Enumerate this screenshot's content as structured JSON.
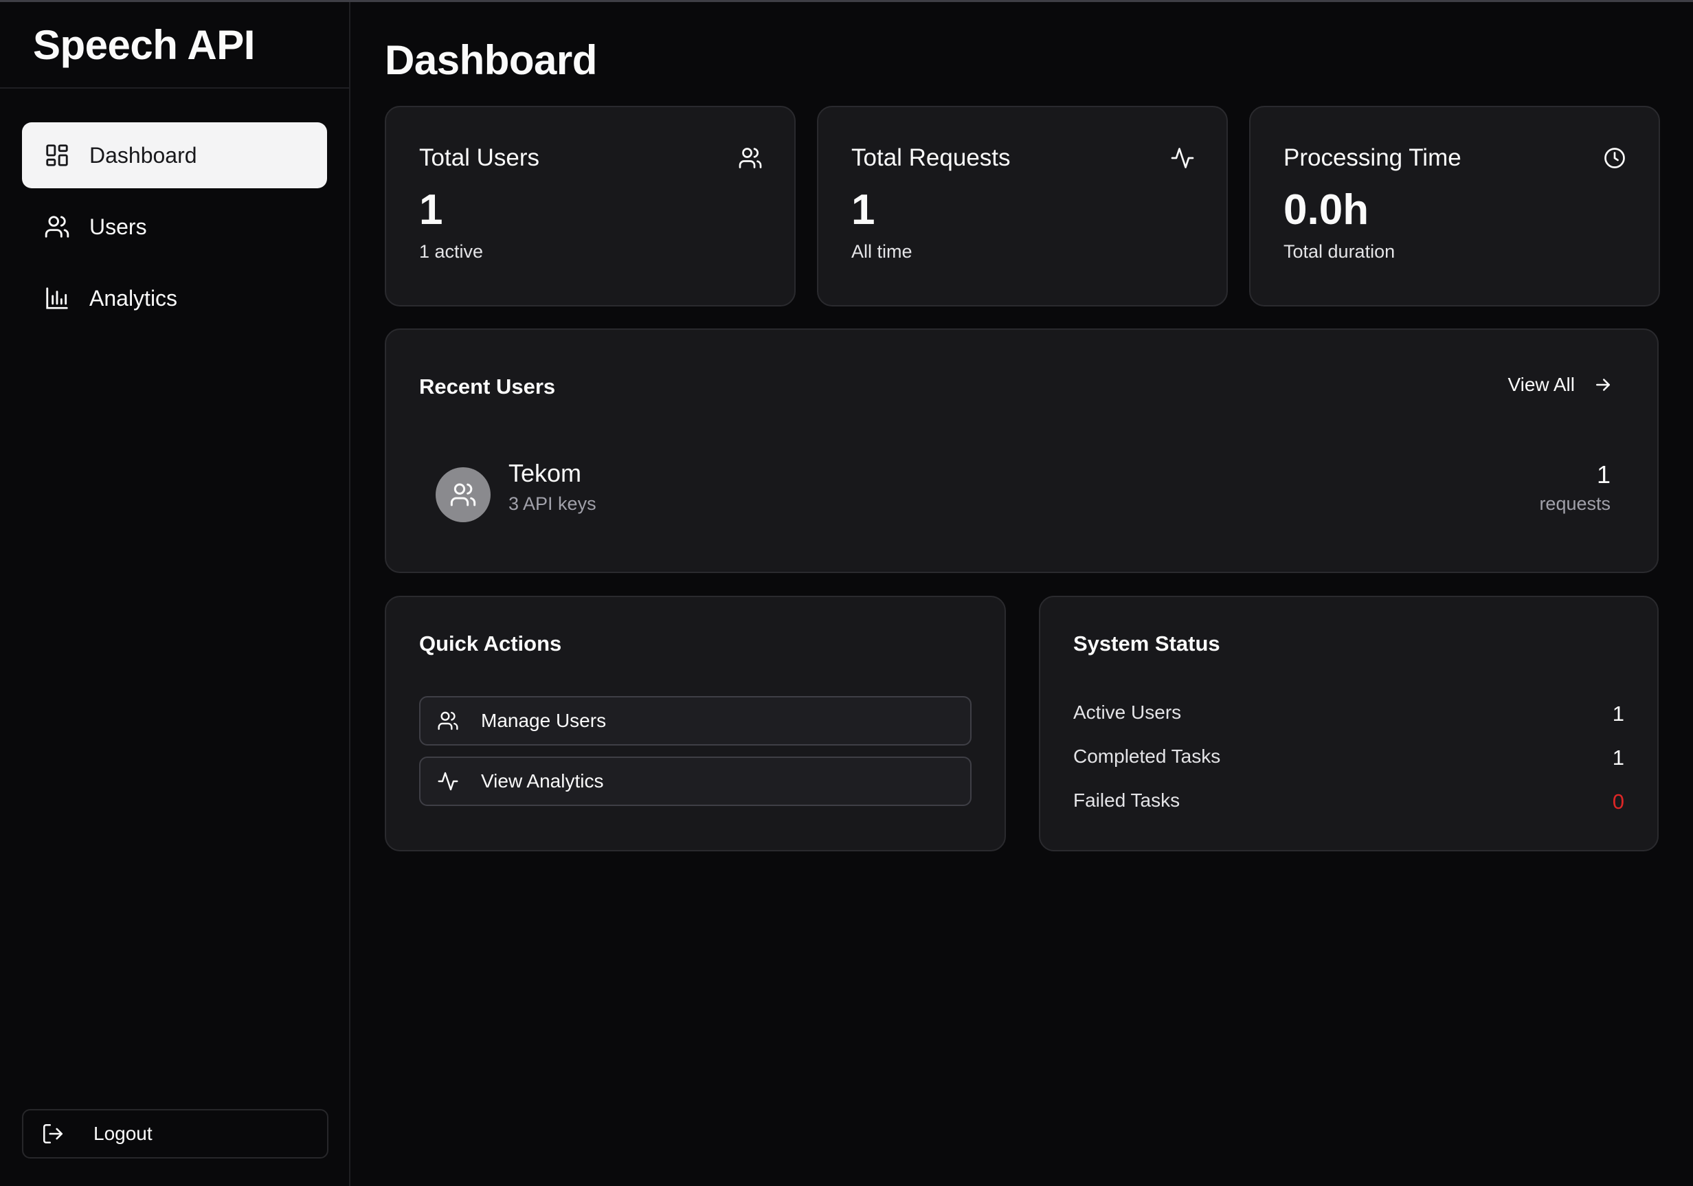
{
  "sidebar": {
    "brand": "Speech API",
    "items": [
      {
        "label": "Dashboard",
        "icon": "dashboard-grid-icon",
        "active": true
      },
      {
        "label": "Users",
        "icon": "users-icon",
        "active": false
      },
      {
        "label": "Analytics",
        "icon": "bar-chart-icon",
        "active": false
      }
    ],
    "logout_label": "Logout"
  },
  "main": {
    "title": "Dashboard",
    "stats": [
      {
        "label": "Total Users",
        "value": "1",
        "sub": "1 active",
        "icon": "users-icon"
      },
      {
        "label": "Total Requests",
        "value": "1",
        "sub": "All time",
        "icon": "activity-icon"
      },
      {
        "label": "Processing Time",
        "value": "0.0h",
        "sub": "Total duration",
        "icon": "clock-icon"
      }
    ],
    "recent_users": {
      "title": "Recent Users",
      "view_all": "View All",
      "users": [
        {
          "name": "Tekom",
          "keys": "3 API keys",
          "requests": "1",
          "requests_label": "requests"
        }
      ]
    },
    "quick_actions": {
      "title": "Quick Actions",
      "actions": [
        {
          "label": "Manage Users",
          "icon": "users-icon"
        },
        {
          "label": "View Analytics",
          "icon": "activity-icon"
        }
      ]
    },
    "system_status": {
      "title": "System Status",
      "rows": [
        {
          "label": "Active Users",
          "value": "1"
        },
        {
          "label": "Completed Tasks",
          "value": "1"
        },
        {
          "label": "Failed Tasks",
          "value": "0",
          "color": "#dc2626"
        }
      ]
    }
  }
}
